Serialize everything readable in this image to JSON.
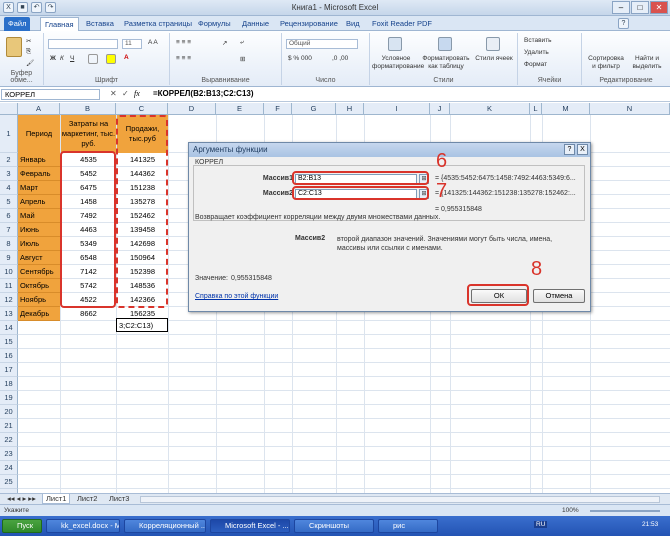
{
  "window": {
    "title": "Книга1  -  Microsoft Excel"
  },
  "tabs": [
    "Файл",
    "Главная",
    "Вставка",
    "Разметка страницы",
    "Формулы",
    "Данные",
    "Рецензирование",
    "Вид",
    "Foxit Reader PDF"
  ],
  "ribbon": {
    "groups": [
      "Буфер обме...",
      "Шрифт",
      "Выравнивание",
      "Число",
      "Стили",
      "Ячейки",
      "Редактирование"
    ],
    "font_size": "11",
    "number_format": "Общий",
    "styles": [
      "Условное форматирование",
      "Форматировать как таблицу",
      "Стили ячеек"
    ],
    "cells_buttons": [
      "Вставить",
      "Удалить",
      "Формат"
    ],
    "edit_buttons": [
      "Сортировка и фильтр",
      "Найти и выделить"
    ]
  },
  "formula_bar": {
    "name_box": "КОРРЕЛ",
    "formula": "=КОРРЕЛ(B2:B13;C2:C13)",
    "fx": "fx"
  },
  "columns": [
    "A",
    "B",
    "C",
    "D",
    "E",
    "F",
    "G",
    "H",
    "I",
    "J",
    "K",
    "L",
    "M",
    "N"
  ],
  "rows": [
    "1",
    "2",
    "3",
    "4",
    "5",
    "6",
    "7",
    "8",
    "9",
    "10",
    "11",
    "12",
    "13",
    "14",
    "15",
    "16",
    "17",
    "18",
    "19",
    "20",
    "21",
    "22",
    "23",
    "24",
    "25",
    "26"
  ],
  "table": {
    "headers": [
      "Период",
      "Затраты на маркетинг, тыс. руб.",
      "Продажи, тыс.руб"
    ],
    "rows": [
      [
        "Январь",
        "4535",
        "141325"
      ],
      [
        "Февраль",
        "5452",
        "144362"
      ],
      [
        "Март",
        "6475",
        "151238"
      ],
      [
        "Апрель",
        "1458",
        "135278"
      ],
      [
        "Май",
        "7492",
        "152462"
      ],
      [
        "Июнь",
        "4463",
        "139458"
      ],
      [
        "Июль",
        "5349",
        "142698"
      ],
      [
        "Август",
        "6548",
        "150964"
      ],
      [
        "Сентябрь",
        "7142",
        "152398"
      ],
      [
        "Октябрь",
        "5742",
        "148536"
      ],
      [
        "Ноябрь",
        "4522",
        "142366"
      ],
      [
        "Декабрь",
        "8662",
        "156235"
      ]
    ],
    "edit_cell": "3;C2:C13)"
  },
  "dialog": {
    "title": "Аргументы функции",
    "group": "КОРРЕЛ",
    "arg1_label": "Массив1",
    "arg1_value": "B2:B13",
    "arg1_result": "= {4535:5452:6475:1458:7492:4463:5349:6...",
    "arg2_label": "Массив2",
    "arg2_value": "C2:C13",
    "arg2_result": "= {141325:144362:151238:135278:152462:...",
    "result_line": "= 0,955315848",
    "description": "Возвращает коэффициент корреляции между двумя множествами данных.",
    "arg_help_label": "Массив2",
    "arg_help": "второй диапазон значений. Значениями могут быть числа, имена, массивы или ссылки с именами.",
    "value_label": "Значение:",
    "value": "0,955315848",
    "help_link": "Справка по этой функции",
    "ok": "ОК",
    "cancel": "Отмена",
    "help_btn": "?",
    "close_btn": "X"
  },
  "annotations": [
    "6",
    "7",
    "8"
  ],
  "sheets": [
    "Лист1",
    "Лист2",
    "Лист3"
  ],
  "status": {
    "mode": "Укажите",
    "zoom": "100%"
  },
  "taskbar": {
    "start": "Пуск",
    "items": [
      "kk_excel.docx - M...",
      "Корреляционный ...",
      "Microsoft Excel - ...",
      "Скриншоты",
      "рис"
    ],
    "lang": "RU",
    "time": "21:53"
  },
  "colors": {
    "header_fill": "#f0a33d",
    "annotation_red": "#d9342b",
    "ribbon_blue": "#2a6fc9"
  }
}
